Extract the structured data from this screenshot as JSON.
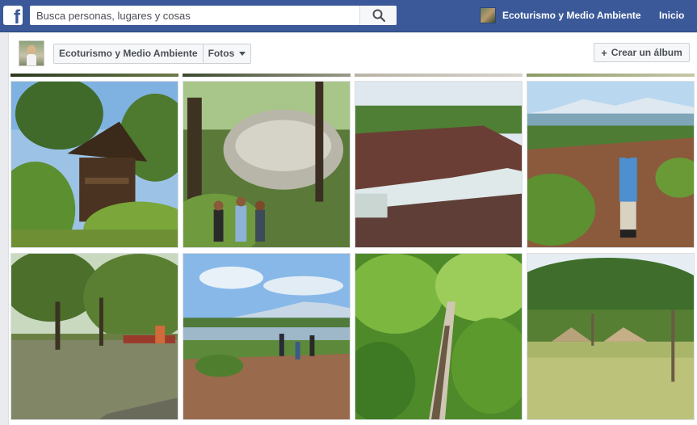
{
  "topbar": {
    "logo": "f",
    "search_placeholder": "Busca personas, lugares y cosas",
    "profile_name": "Ecoturismo y Medio Ambiente",
    "home_label": "Inicio"
  },
  "subheader": {
    "page_name": "Ecoturismo y Medio Ambiente",
    "section_selected": "Fotos",
    "create_album_label": "Crear un álbum"
  },
  "icons": {
    "logo": "facebook-logo-icon",
    "search": "search-icon",
    "caret": "chevron-down-icon",
    "plus": "plus-icon"
  },
  "colors": {
    "brand_blue": "#3b5998",
    "page_bg": "#e9ebee",
    "button_bg": "#f6f7f9",
    "text": "#4b4f56"
  }
}
